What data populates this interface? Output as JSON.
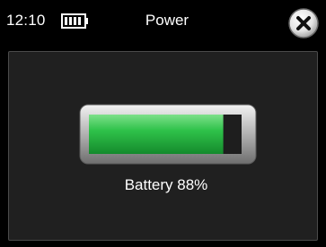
{
  "status_bar": {
    "time": "12:10",
    "battery_icon": "battery-full-icon",
    "title": "Power",
    "close_icon": "close-icon"
  },
  "battery": {
    "label": "Battery 88%",
    "level_percent": 88
  },
  "colors": {
    "battery_fill": "#2fc24a",
    "panel_background": "#202020",
    "background": "#000000"
  }
}
